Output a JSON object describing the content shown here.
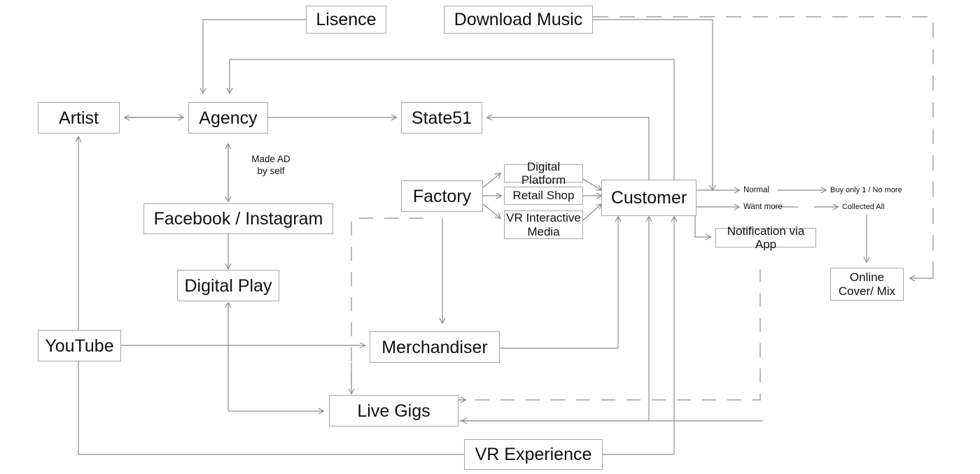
{
  "diagram": {
    "title": "Music Industry Value Chain Flow Diagram",
    "stroke_color": "#8c8c8c",
    "box_border_color": "#a6a6a6",
    "text_color": "#101010",
    "background": "#ffffff"
  },
  "nodes": {
    "lisence": "Lisence",
    "download_music": "Download Music",
    "artist": "Artist",
    "agency": "Agency",
    "state51": "State51",
    "facebook_instagram": "Facebook / Instagram",
    "factory": "Factory",
    "digital_platform": "Digital Platform",
    "retail_shop": "Retail Shop",
    "vr_interactive_media": "VR Interactive Media",
    "customer": "Customer",
    "notification_via_app": "Notification via App",
    "online_cover_mix": "Online Cover/ Mix",
    "digital_play": "Digital Play",
    "youtube": "YouTube",
    "merchandiser": "Merchandiser",
    "live_gigs": "Live Gigs",
    "vr_experience": "VR Experience"
  },
  "labels": {
    "made_ad_by_self": "Made AD\nby self",
    "normal": "Normal",
    "want_more": "Want more",
    "buy_only_one": "Buy only 1 / No more",
    "collected_all": "Collected All"
  }
}
